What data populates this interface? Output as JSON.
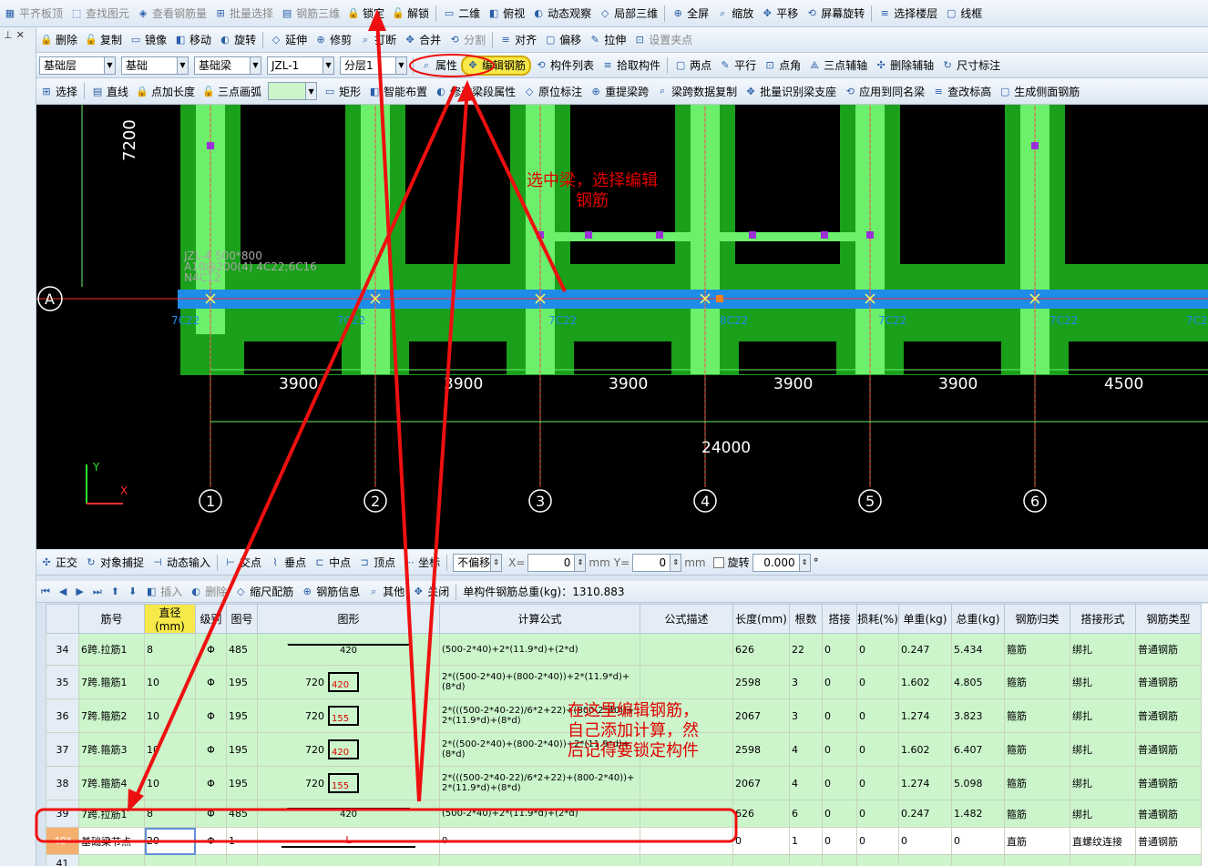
{
  "toolbar1": {
    "items": [
      "平齐板顶",
      "查找图元",
      "查看钢筋量",
      "批量选择",
      "钢筋三维",
      "锁定",
      "解锁",
      "二维",
      "俯视",
      "动态观察",
      "局部三维",
      "全屏",
      "缩放",
      "平移",
      "屏幕旋转",
      "选择楼层",
      "线框"
    ]
  },
  "toolbar2": {
    "items": [
      "删除",
      "复制",
      "镜像",
      "移动",
      "旋转",
      "延伸",
      "修剪",
      "打断",
      "合并",
      "分割",
      "对齐",
      "偏移",
      "拉伸",
      "设置夹点"
    ]
  },
  "toolbar3": {
    "selects": [
      "基础层",
      "基础",
      "基础梁",
      "JZL-1",
      "分层1"
    ],
    "items": [
      "属性",
      "编辑钢筋",
      "构件列表",
      "拾取构件",
      "两点",
      "平行",
      "点角",
      "三点辅轴",
      "删除辅轴",
      "尺寸标注"
    ]
  },
  "toolbar4": {
    "items": [
      "选择",
      "直线",
      "点加长度",
      "三点画弧",
      "矩形",
      "智能布置",
      "修改梁段属性",
      "原位标注",
      "重提梁跨",
      "梁跨数据复制",
      "批量识别梁支座",
      "应用到同名梁",
      "查改标高",
      "生成侧面钢筋"
    ]
  },
  "canvas": {
    "axis_label": "7200",
    "beam_label_1": "JZL-4 500*800",
    "beam_label_2": "A10@200(4) 4C22;6C16",
    "beam_label_3": "N4C12",
    "row_label": "A",
    "rebar_labels": [
      "7C22",
      "7C22",
      "7C22",
      "8C22",
      "7C22",
      "7C22",
      "7C2"
    ],
    "spans": [
      "3900",
      "3900",
      "3900",
      "3900",
      "3900",
      "4500"
    ],
    "total": "24000",
    "axes": [
      "1",
      "2",
      "3",
      "4",
      "5",
      "6"
    ],
    "y_label": "Y",
    "x_label": "X"
  },
  "annotations": {
    "top": "选中梁，选择编辑\n钢筋",
    "bottom": "在这里编辑钢筋，\n自己添加计算，然\n后记得要锁定构件"
  },
  "statusbar": {
    "items": [
      "正交",
      "对象捕捉",
      "动态输入",
      "交点",
      "垂点",
      "中点",
      "顶点",
      "坐标"
    ],
    "offset_mode": "不偏移",
    "x_label": "X=",
    "x_value": "0",
    "y_label": "Y=",
    "y_value": "0",
    "unit": "mm",
    "rotate_label": "旋转",
    "rotate_value": "0.000",
    "deg": "°"
  },
  "gridtool": {
    "items": [
      "插入",
      "删除",
      "缩尺配筋",
      "钢筋信息",
      "其他",
      "关闭"
    ],
    "total_weight": "单构件钢筋总重(kg)：1310.883"
  },
  "table": {
    "headers": [
      "筋号",
      "直径(mm)",
      "级别",
      "图号",
      "图形",
      "计算公式",
      "公式描述",
      "长度(mm)",
      "根数",
      "搭接",
      "损耗(%)",
      "单重(kg)",
      "总重(kg)",
      "钢筋归类",
      "搭接形式",
      "钢筋类型"
    ],
    "rows": [
      {
        "n": "34",
        "name": "6跨.拉筋1",
        "d": "8",
        "lv": "Φ",
        "fig": "485",
        "shape": "420",
        "pre": "",
        "f": "(500-2*40)+2*(11.9*d)+(2*d)",
        "len": "626",
        "cnt": "22",
        "lap": "0",
        "loss": "0",
        "uw": "0.247",
        "tw": "5.434",
        "cat": "箍筋",
        "lt": "绑扎",
        "type": "普通钢筋"
      },
      {
        "n": "35",
        "name": "7跨.箍筋1",
        "d": "10",
        "lv": "Φ",
        "fig": "195",
        "shape": "420",
        "pre": "720",
        "f": "2*((500-2*40)+(800-2*40))+2*(11.9*d)+(8*d)",
        "len": "2598",
        "cnt": "3",
        "lap": "0",
        "loss": "0",
        "uw": "1.602",
        "tw": "4.805",
        "cat": "箍筋",
        "lt": "绑扎",
        "type": "普通钢筋"
      },
      {
        "n": "36",
        "name": "7跨.箍筋2",
        "d": "10",
        "lv": "Φ",
        "fig": "195",
        "shape": "155",
        "pre": "720",
        "f": "2*(((500-2*40-22)/6*2+22)+(800-2*40))+2*(11.9*d)+(8*d)",
        "len": "2067",
        "cnt": "3",
        "lap": "0",
        "loss": "0",
        "uw": "1.274",
        "tw": "3.823",
        "cat": "箍筋",
        "lt": "绑扎",
        "type": "普通钢筋"
      },
      {
        "n": "37",
        "name": "7跨.箍筋3",
        "d": "10",
        "lv": "Φ",
        "fig": "195",
        "shape": "420",
        "pre": "720",
        "f": "2*((500-2*40)+(800-2*40))+2*(11.9*d)+(8*d)",
        "len": "2598",
        "cnt": "4",
        "lap": "0",
        "loss": "0",
        "uw": "1.602",
        "tw": "6.407",
        "cat": "箍筋",
        "lt": "绑扎",
        "type": "普通钢筋"
      },
      {
        "n": "38",
        "name": "7跨.箍筋4",
        "d": "10",
        "lv": "Φ",
        "fig": "195",
        "shape": "155",
        "pre": "720",
        "f": "2*(((500-2*40-22)/6*2+22)+(800-2*40))+2*(11.9*d)+(8*d)",
        "len": "2067",
        "cnt": "4",
        "lap": "0",
        "loss": "0",
        "uw": "1.274",
        "tw": "5.098",
        "cat": "箍筋",
        "lt": "绑扎",
        "type": "普通钢筋"
      },
      {
        "n": "39",
        "name": "7跨.拉筋1",
        "d": "8",
        "lv": "Φ",
        "fig": "485",
        "shape": "420",
        "pre": "",
        "f": "(500-2*40)+2*(11.9*d)+(2*d)",
        "len": "626",
        "cnt": "6",
        "lap": "0",
        "loss": "0",
        "uw": "0.247",
        "tw": "1.482",
        "cat": "箍筋",
        "lt": "绑扎",
        "type": "普通钢筋"
      },
      {
        "n": "40*",
        "name": "基础梁节点",
        "d": "20",
        "lv": "Φ",
        "fig": "1",
        "shape": "L",
        "pre": "",
        "f": "0",
        "len": "0",
        "cnt": "1",
        "lap": "0",
        "loss": "0",
        "uw": "0",
        "tw": "0",
        "cat": "直筋",
        "lt": "直螺纹连接",
        "type": "普通钢筋"
      },
      {
        "n": "41",
        "name": "",
        "d": "",
        "lv": "",
        "fig": "",
        "shape": "",
        "pre": "",
        "f": "",
        "len": "",
        "cnt": "",
        "lap": "",
        "loss": "",
        "uw": "",
        "tw": "",
        "cat": "",
        "lt": "",
        "type": ""
      }
    ]
  },
  "colors": {
    "beam": "#1e8ce8",
    "green": "#1aa01a",
    "lightgreen": "#6cf06c",
    "canvas": "#000000",
    "arrow": "#ee1010"
  }
}
